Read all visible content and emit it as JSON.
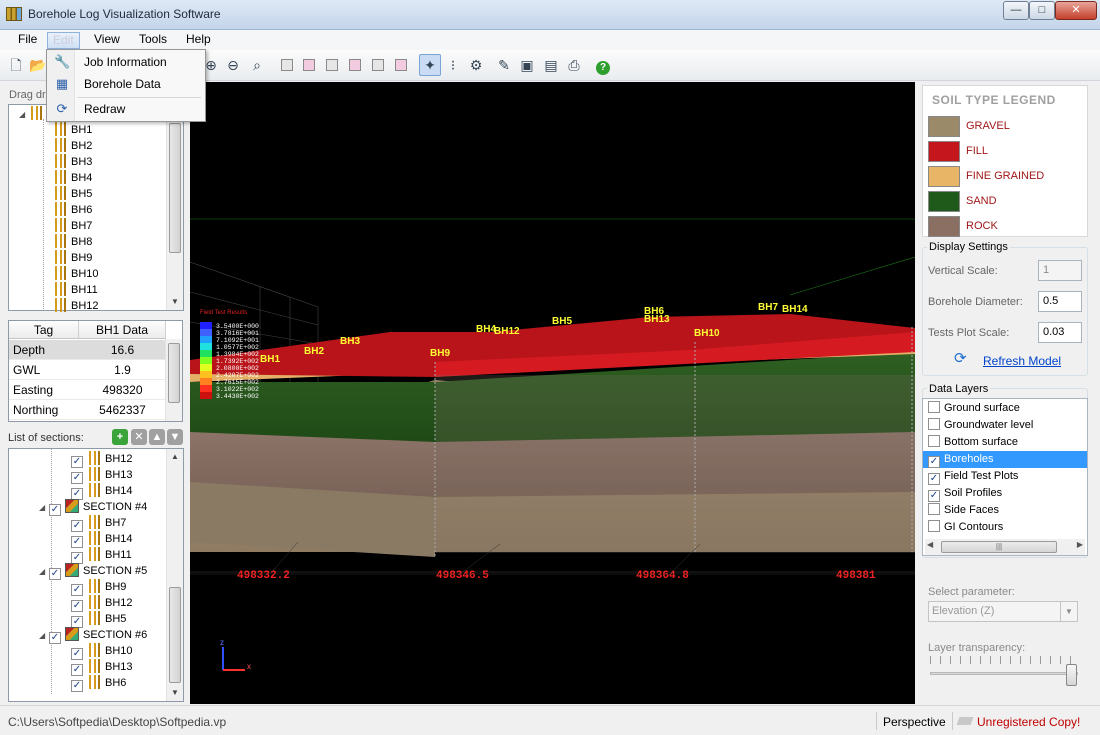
{
  "window": {
    "title": "Borehole Log Visualization Software",
    "min": "—",
    "max": "□",
    "close": "✕"
  },
  "menu": {
    "items": [
      "File",
      "Edit",
      "View",
      "Tools",
      "Help"
    ]
  },
  "edit_menu": {
    "items": [
      {
        "label": "Job Information",
        "icon": "wrench-icon"
      },
      {
        "label": "Borehole Data",
        "icon": "spreadsheet-icon"
      },
      {
        "label": "Redraw",
        "icon": "refresh-icon"
      }
    ]
  },
  "left": {
    "drag_hint": "Drag  dr",
    "tree": {
      "boreholes": [
        "BH1",
        "BH2",
        "BH3",
        "BH4",
        "BH5",
        "BH6",
        "BH7",
        "BH8",
        "BH9",
        "BH10",
        "BH11",
        "BH12"
      ]
    },
    "props": {
      "headers": [
        "Tag",
        "BH1 Data"
      ],
      "rows": [
        {
          "tag": "Depth",
          "value": "16.6"
        },
        {
          "tag": "GWL",
          "value": "1.9"
        },
        {
          "tag": "Easting",
          "value": "498320"
        },
        {
          "tag": "Northing",
          "value": "5462337"
        }
      ]
    },
    "sections_label": "List of sections:",
    "sections_tree": [
      {
        "kind": "bh",
        "label": "BH12"
      },
      {
        "kind": "bh",
        "label": "BH13"
      },
      {
        "kind": "bh",
        "label": "BH14"
      },
      {
        "kind": "section",
        "label": "SECTION #4"
      },
      {
        "kind": "bh",
        "label": "BH7"
      },
      {
        "kind": "bh",
        "label": "BH14"
      },
      {
        "kind": "bh",
        "label": "BH11"
      },
      {
        "kind": "section",
        "label": "SECTION #5"
      },
      {
        "kind": "bh",
        "label": "BH9"
      },
      {
        "kind": "bh",
        "label": "BH12"
      },
      {
        "kind": "bh",
        "label": "BH5"
      },
      {
        "kind": "section",
        "label": "SECTION #6"
      },
      {
        "kind": "bh",
        "label": "BH10"
      },
      {
        "kind": "bh",
        "label": "BH13"
      },
      {
        "kind": "bh",
        "label": "BH6"
      }
    ]
  },
  "viewport": {
    "field_tests_title": "Field Test Results",
    "scale_values": [
      "3.5400E+000",
      "3.7816E+001",
      "7.1092E+001",
      "1.0577E+002",
      "1.3984E+002",
      "1.7392E+002",
      "2.0800E+002",
      "2.4207E+002",
      "2.7615E+002",
      "3.1022E+002",
      "3.4430E+002"
    ],
    "borehole_labels": [
      "BH1",
      "BH2",
      "BH3",
      "BH4",
      "BH12",
      "BH5",
      "BH6",
      "BH13",
      "BH7",
      "BH14",
      "BH9",
      "BH10"
    ],
    "axis_ticks": [
      "498332.2",
      "498346.5",
      "498364.8",
      "498381"
    ],
    "axis_z": "z",
    "axis_x": "x"
  },
  "legend": {
    "title": "SOIL TYPE LEGEND",
    "items": [
      {
        "label": "GRAVEL",
        "color": "#9a8a6a"
      },
      {
        "label": "FILL",
        "color": "#c4161c"
      },
      {
        "label": "FINE GRAINED",
        "color": "#e8b566"
      },
      {
        "label": "SAND",
        "color": "#1f5a1a"
      },
      {
        "label": "ROCK",
        "color": "#8a6f62"
      }
    ]
  },
  "display": {
    "title": "Display Settings",
    "vertical_scale_label": "Vertical Scale:",
    "vertical_scale": "1",
    "diameter_label": "Borehole Diameter:",
    "diameter": "0.5",
    "tests_scale_label": "Tests Plot Scale:",
    "tests_scale": "0.03",
    "refresh_label": "Refresh Model"
  },
  "layers": {
    "title": "Data Layers",
    "items": [
      {
        "label": "Ground surface",
        "checked": false
      },
      {
        "label": "Groundwater level",
        "checked": false
      },
      {
        "label": "Bottom surface",
        "checked": false
      },
      {
        "label": "Boreholes",
        "checked": true,
        "selected": true
      },
      {
        "label": "Field Test Plots",
        "checked": true
      },
      {
        "label": "Soil Profiles",
        "checked": true
      },
      {
        "label": "Side Faces",
        "checked": false
      },
      {
        "label": "GI Contours",
        "checked": false
      }
    ]
  },
  "param": {
    "label": "Select parameter:",
    "value": "Elevation (Z)"
  },
  "transparency": {
    "label": "Layer transparency:",
    "level": 1.0
  },
  "status": {
    "path": "C:\\Users\\Softpedia\\Desktop\\Softpedia.vp",
    "mode": "Perspective",
    "registration": "Unregistered Copy!"
  },
  "colors": {
    "accent": "#3399ff",
    "brand_red": "#c00000"
  }
}
